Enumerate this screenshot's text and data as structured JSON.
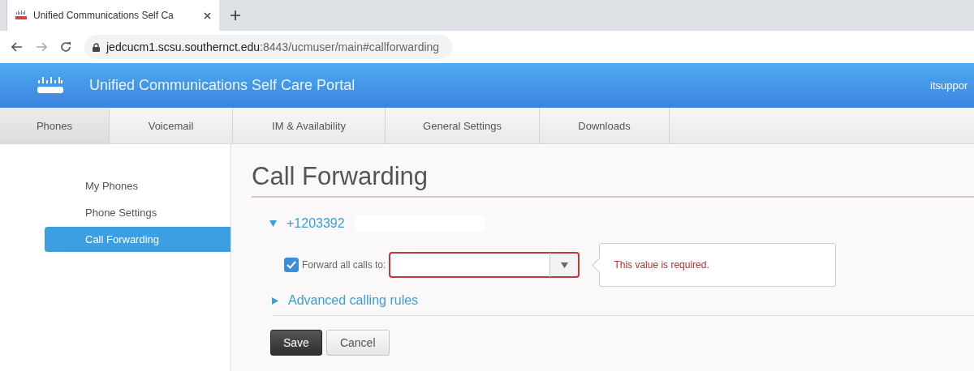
{
  "browser": {
    "tab_title": "Unified Communications Self Ca",
    "host": "jedcucm1.scsu.southernct.edu",
    "path": ":8443/ucmuser/main#callforwarding"
  },
  "header": {
    "title": "Unified Communications Self Care Portal",
    "user": "itsuppor"
  },
  "tabs": [
    {
      "label": "Phones",
      "selected": true
    },
    {
      "label": "Voicemail",
      "selected": false
    },
    {
      "label": "IM & Availability",
      "selected": false
    },
    {
      "label": "General Settings",
      "selected": false
    },
    {
      "label": "Downloads",
      "selected": false
    }
  ],
  "sidebar": {
    "items": [
      {
        "label": "My Phones",
        "selected": false
      },
      {
        "label": "Phone Settings",
        "selected": false
      },
      {
        "label": "Call Forwarding",
        "selected": true
      }
    ]
  },
  "main": {
    "heading": "Call Forwarding",
    "line": {
      "number": "+1203392",
      "expanded": true
    },
    "forward_all": {
      "label": "Forward all calls to:",
      "checked": true,
      "error": "This value is required."
    },
    "advanced": {
      "label": "Advanced calling rules",
      "expanded": false
    },
    "buttons": [
      {
        "label": "Save",
        "kind": "primary"
      },
      {
        "label": "Cancel",
        "kind": "secondary"
      }
    ]
  }
}
